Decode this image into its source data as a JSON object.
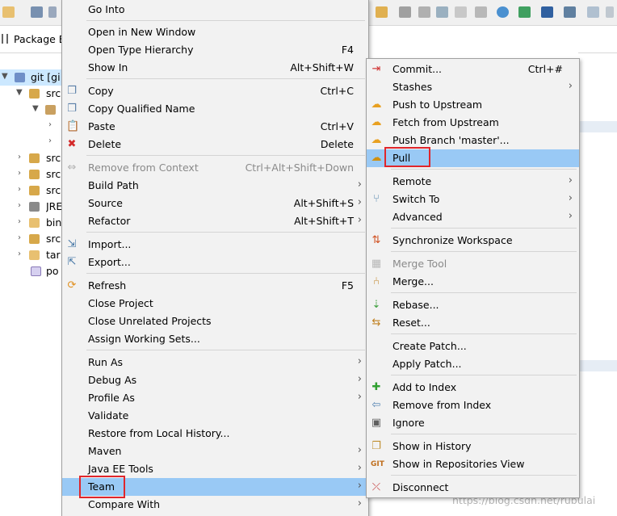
{
  "view_tab": {
    "title": "Package E"
  },
  "tree": {
    "root": "git [gi",
    "rows": [
      "src",
      "src",
      "src",
      "src",
      "JRE",
      "bin",
      "src",
      "tar",
      "po"
    ]
  },
  "main_menu": {
    "items": [
      {
        "label": "Go Into",
        "accel": ""
      },
      {
        "label": "Open in New Window",
        "accel": ""
      },
      {
        "label": "Open Type Hierarchy",
        "accel": "F4"
      },
      {
        "label": "Show In",
        "accel": "Alt+Shift+W"
      },
      {
        "label": "Copy",
        "accel": "Ctrl+C"
      },
      {
        "label": "Copy Qualified Name",
        "accel": ""
      },
      {
        "label": "Paste",
        "accel": "Ctrl+V"
      },
      {
        "label": "Delete",
        "accel": "Delete"
      },
      {
        "label": "Remove from Context",
        "accel": "Ctrl+Alt+Shift+Down"
      },
      {
        "label": "Build Path",
        "accel": ""
      },
      {
        "label": "Source",
        "accel": "Alt+Shift+S"
      },
      {
        "label": "Refactor",
        "accel": "Alt+Shift+T"
      },
      {
        "label": "Import...",
        "accel": ""
      },
      {
        "label": "Export...",
        "accel": ""
      },
      {
        "label": "Refresh",
        "accel": "F5"
      },
      {
        "label": "Close Project",
        "accel": ""
      },
      {
        "label": "Close Unrelated Projects",
        "accel": ""
      },
      {
        "label": "Assign Working Sets...",
        "accel": ""
      },
      {
        "label": "Run As",
        "accel": ""
      },
      {
        "label": "Debug As",
        "accel": ""
      },
      {
        "label": "Profile As",
        "accel": ""
      },
      {
        "label": "Validate",
        "accel": ""
      },
      {
        "label": "Restore from Local History...",
        "accel": ""
      },
      {
        "label": "Maven",
        "accel": ""
      },
      {
        "label": "Java EE Tools",
        "accel": ""
      },
      {
        "label": "Team",
        "accel": ""
      },
      {
        "label": "Compare With",
        "accel": ""
      }
    ]
  },
  "team_menu": {
    "items": [
      {
        "label": "Commit...",
        "accel": "Ctrl+#"
      },
      {
        "label": "Stashes",
        "accel": ""
      },
      {
        "label": "Push to Upstream",
        "accel": ""
      },
      {
        "label": "Fetch from Upstream",
        "accel": ""
      },
      {
        "label": "Push Branch 'master'...",
        "accel": ""
      },
      {
        "label": "Pull",
        "accel": ""
      },
      {
        "label": "Remote",
        "accel": ""
      },
      {
        "label": "Switch To",
        "accel": ""
      },
      {
        "label": "Advanced",
        "accel": ""
      },
      {
        "label": "Synchronize Workspace",
        "accel": ""
      },
      {
        "label": "Merge Tool",
        "accel": ""
      },
      {
        "label": "Merge...",
        "accel": ""
      },
      {
        "label": "Rebase...",
        "accel": ""
      },
      {
        "label": "Reset...",
        "accel": ""
      },
      {
        "label": "Create Patch...",
        "accel": ""
      },
      {
        "label": "Apply Patch...",
        "accel": ""
      },
      {
        "label": "Add to Index",
        "accel": ""
      },
      {
        "label": "Remove from Index",
        "accel": ""
      },
      {
        "label": "Ignore",
        "accel": ""
      },
      {
        "label": "Show in History",
        "accel": ""
      },
      {
        "label": "Show in Repositories View",
        "accel": ""
      },
      {
        "label": "Disconnect",
        "accel": ""
      }
    ]
  },
  "watermark": "https://blog.csdn.net/rubulai",
  "colors": {
    "menu_bg": "#f2f2f2",
    "highlight": "#99c9f5",
    "red_annotation": "#e0262b",
    "tree_selection": "#cce8ff"
  }
}
